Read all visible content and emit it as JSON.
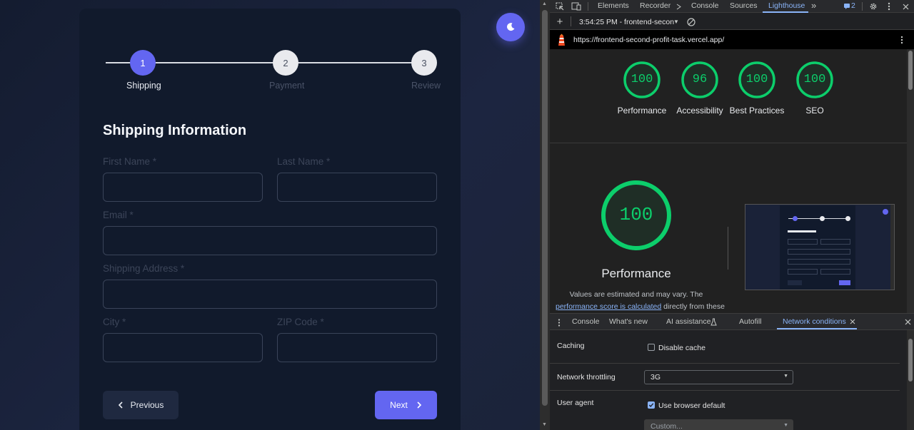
{
  "app": {
    "steps": [
      {
        "number": "1",
        "label": "Shipping"
      },
      {
        "number": "2",
        "label": "Payment"
      },
      {
        "number": "3",
        "label": "Review"
      }
    ],
    "form_title": "Shipping Information",
    "fields": {
      "first_name": {
        "label": "First Name *",
        "value": ""
      },
      "last_name": {
        "label": "Last Name *",
        "value": ""
      },
      "email": {
        "label": "Email *",
        "value": ""
      },
      "address": {
        "label": "Shipping Address *",
        "value": ""
      },
      "city": {
        "label": "City *",
        "value": ""
      },
      "zip": {
        "label": "ZIP Code *",
        "value": ""
      }
    },
    "buttons": {
      "previous": "Previous",
      "next": "Next"
    },
    "colors": {
      "accent": "#6366f1",
      "card": "#111a2c",
      "background": "#1a2035"
    },
    "icons": {
      "theme_toggle": "moon-icon",
      "previous": "chevron-left-icon",
      "next": "chevron-right-icon"
    }
  },
  "devtools": {
    "tabs": [
      "Elements",
      "Recorder",
      "Console",
      "Sources",
      "Lighthouse"
    ],
    "active_tab": "Lighthouse",
    "issues_count": "2",
    "report_selector": "3:54:25 PM - frontend-secon",
    "url": "https://frontend-second-profit-task.vercel.app/",
    "scores": [
      {
        "value": "100",
        "label": "Performance"
      },
      {
        "value": "96",
        "label": "Accessibility"
      },
      {
        "value": "100",
        "label": "Best Practices"
      },
      {
        "value": "100",
        "label": "SEO"
      }
    ],
    "performance": {
      "score": "100",
      "title": "Performance",
      "note_before": "Values are estimated and may vary. The",
      "note_link": "performance score is calculated",
      "note_after": "directly from these"
    },
    "drawer_tabs": [
      "Console",
      "What's new",
      "AI assistance",
      "Autofill",
      "Network conditions"
    ],
    "active_drawer_tab": "Network conditions",
    "network_conditions": {
      "caching_label": "Caching",
      "disable_cache_label": "Disable cache",
      "disable_cache_checked": false,
      "throttling_label": "Network throttling",
      "throttling_value": "3G",
      "user_agent_label": "User agent",
      "use_default_label": "Use browser default",
      "use_default_checked": true,
      "custom_placeholder": "Custom..."
    },
    "colors": {
      "pass": "#0cce6b",
      "link": "#8ab4f8",
      "panel": "#202124"
    }
  }
}
